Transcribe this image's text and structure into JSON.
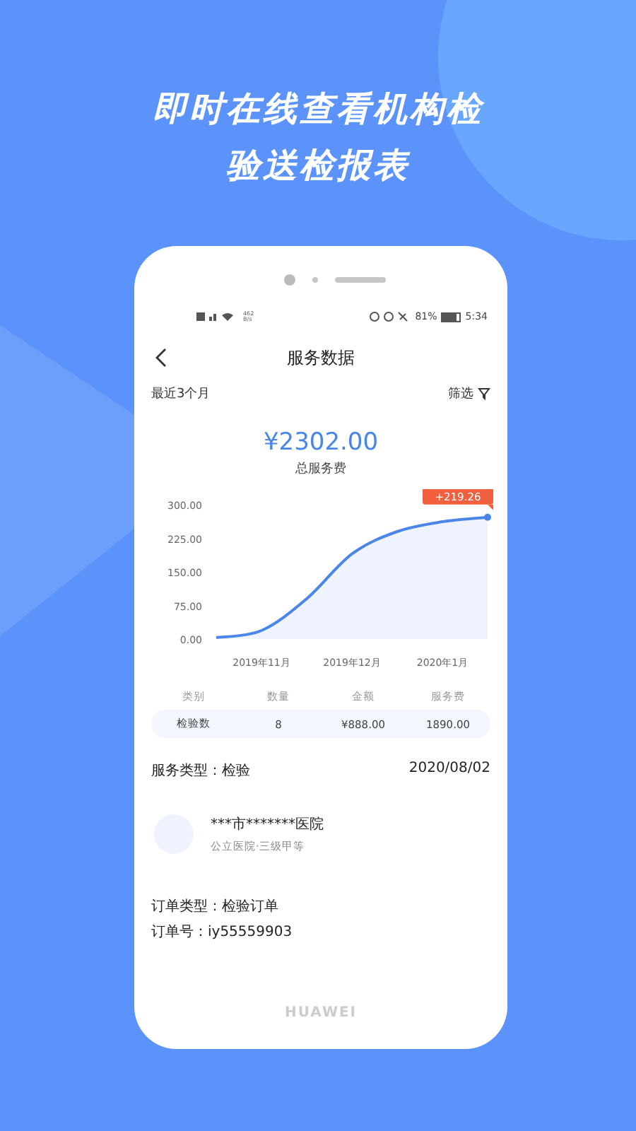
{
  "headline": [
    "即时在线查看机构检",
    "验送检报表"
  ],
  "status_bar": {
    "net_speed": [
      "462",
      "B/s"
    ],
    "battery": "81%",
    "time": "5:34"
  },
  "nav": {
    "title": "服务数据"
  },
  "filter_bar": {
    "period": "最近3个月",
    "filter": "筛选"
  },
  "summary": {
    "amount": "¥2302.00",
    "label": "总服务费"
  },
  "chart_data": {
    "type": "area",
    "categories": [
      null,
      "2019年11月",
      null,
      "2019年12月",
      null,
      "2020年1月",
      null
    ],
    "series": [
      {
        "color": "#4a86e8",
        "values": [
          3,
          19,
          90,
          190,
          240,
          262,
          272
        ]
      }
    ],
    "ylim": [
      0,
      300
    ],
    "yticks": [
      {
        "value": 0,
        "label": "0.00"
      },
      {
        "value": 75,
        "label": "75.00"
      },
      {
        "value": 150,
        "label": "150.00"
      },
      {
        "value": 225,
        "label": "225.00"
      },
      {
        "value": 300,
        "label": "300.00"
      }
    ],
    "annotations": [
      "+219.26"
    ]
  },
  "table": {
    "columns": [
      "类别",
      "数量",
      "金额",
      "服务费"
    ],
    "rows": [
      [
        "检验数",
        "8",
        "¥888.00",
        "1890.00"
      ]
    ]
  },
  "order": {
    "service_type": "服务类型：检验",
    "date": "2020/08/02",
    "hospital": "***市*******医院",
    "hospital_info": "公立医院·三级甲等",
    "order_type": "订单类型：检验订单",
    "order_no": "订单号：iy55559903"
  },
  "phone": {
    "brand": "HUAWEI"
  }
}
